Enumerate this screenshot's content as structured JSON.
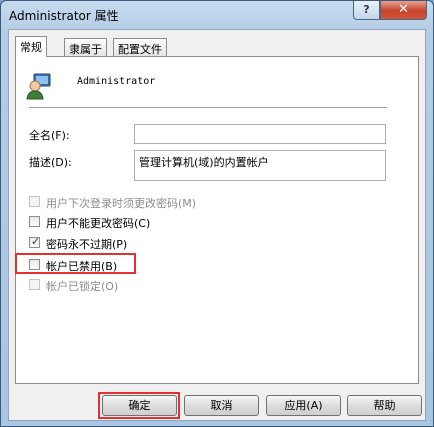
{
  "window": {
    "title": "Administrator 属性",
    "help_glyph": "?",
    "close_glyph": "✕"
  },
  "tabs": [
    {
      "label": "常规",
      "active": true
    },
    {
      "label": "隶属于",
      "active": false
    },
    {
      "label": "配置文件",
      "active": false
    }
  ],
  "user": {
    "name": "Administrator"
  },
  "form": {
    "fullname_label": "全名(F):",
    "fullname_value": "",
    "description_label": "描述(D):",
    "description_value": "管理计算机(域)的内置帐户"
  },
  "checkboxes": [
    {
      "label": "用户下次登录时须更改密码(M)",
      "checked": false,
      "enabled": false
    },
    {
      "label": "用户不能更改密码(C)",
      "checked": false,
      "enabled": true
    },
    {
      "label": "密码永不过期(P)",
      "checked": true,
      "enabled": true
    },
    {
      "label": "帐户已禁用(B)",
      "checked": false,
      "enabled": true,
      "highlighted": true
    },
    {
      "label": "帐户已锁定(O)",
      "checked": false,
      "enabled": false
    }
  ],
  "buttons": {
    "ok": "确定",
    "cancel": "取消",
    "apply": "应用(A)",
    "help": "帮助"
  },
  "check_glyph": "✓",
  "colors": {
    "highlight": "#e53030",
    "title_bar": "#b5cde6",
    "close_button": "#c7432a"
  }
}
